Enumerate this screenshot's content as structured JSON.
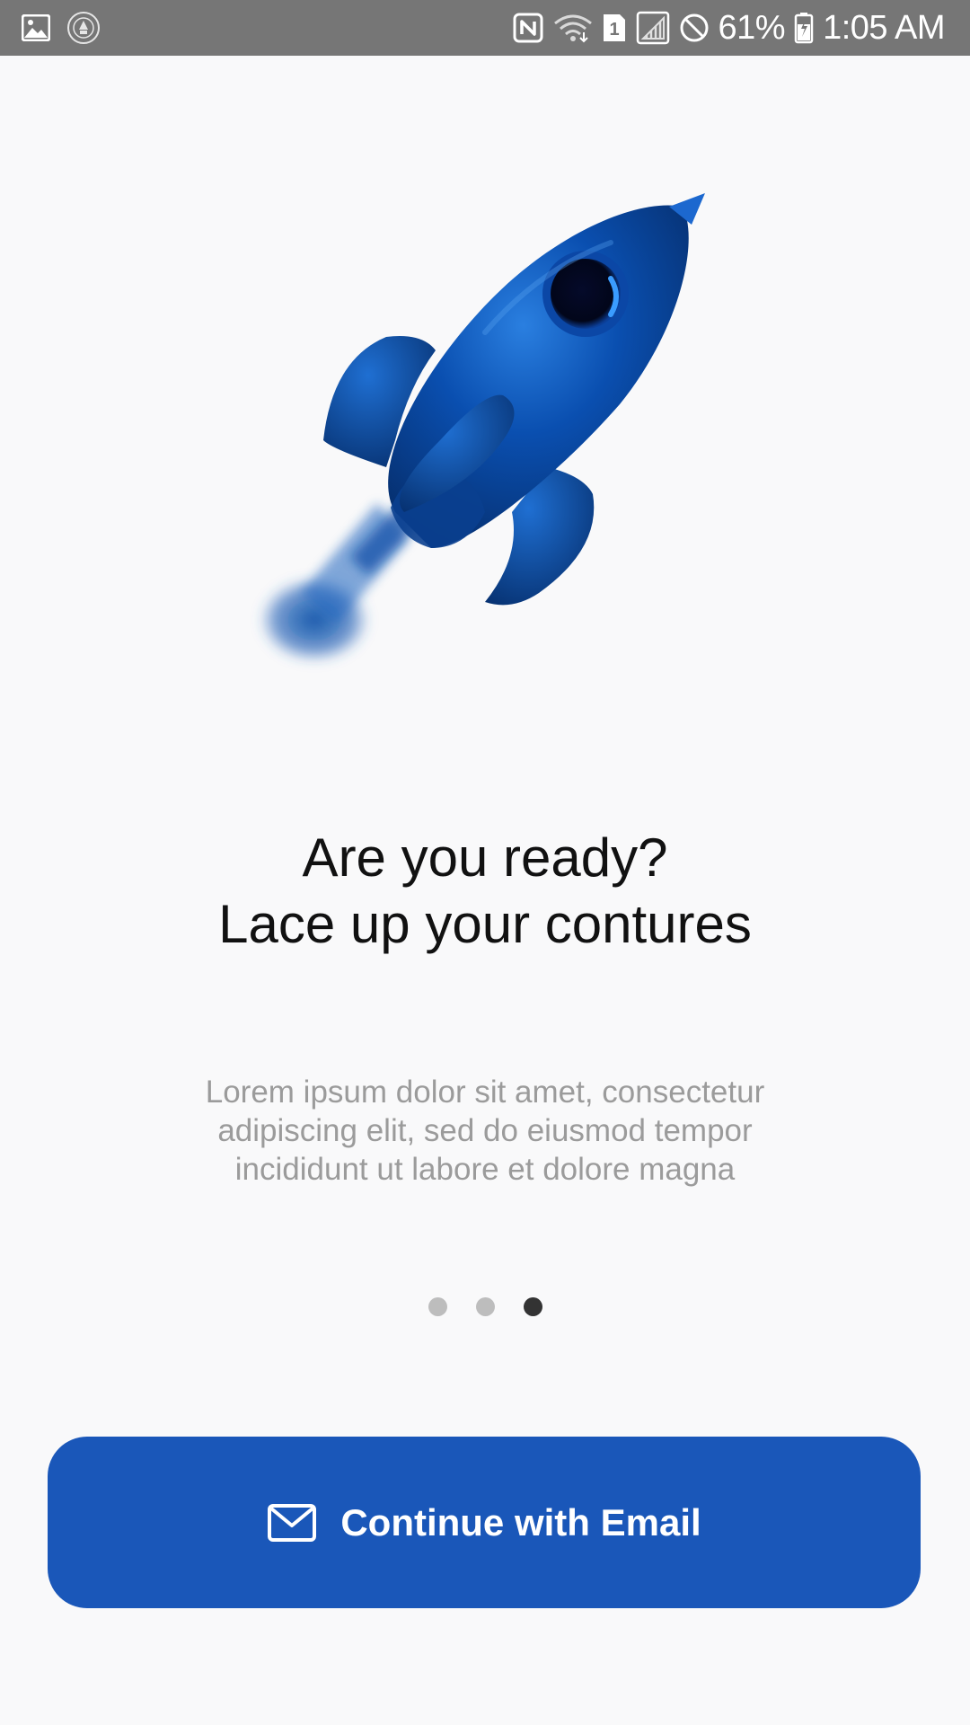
{
  "status_bar": {
    "battery_percent": "61%",
    "time": "1:05 AM",
    "sim_badge": "1",
    "background_color": "#767676",
    "icons": [
      "gallery-icon",
      "app-badge-icon",
      "nfc-icon",
      "wifi-icon",
      "sim-icon",
      "signal-icon",
      "do-not-disturb-icon",
      "battery-icon"
    ]
  },
  "hero": {
    "illustration": "rocket-illustration",
    "accent_color": "#0a4fb0"
  },
  "onboarding": {
    "title_line1": "Are you ready?",
    "title_line2": "Lace up your contures",
    "description": "Lorem ipsum dolor sit amet, consectetur adipiscing elit, sed do eiusmod tempor incididunt ut labore et dolore magna",
    "page_count": 3,
    "current_page": 3
  },
  "cta": {
    "label": "Continue with Email",
    "icon": "mail-icon",
    "background_color": "#1a57b9"
  }
}
